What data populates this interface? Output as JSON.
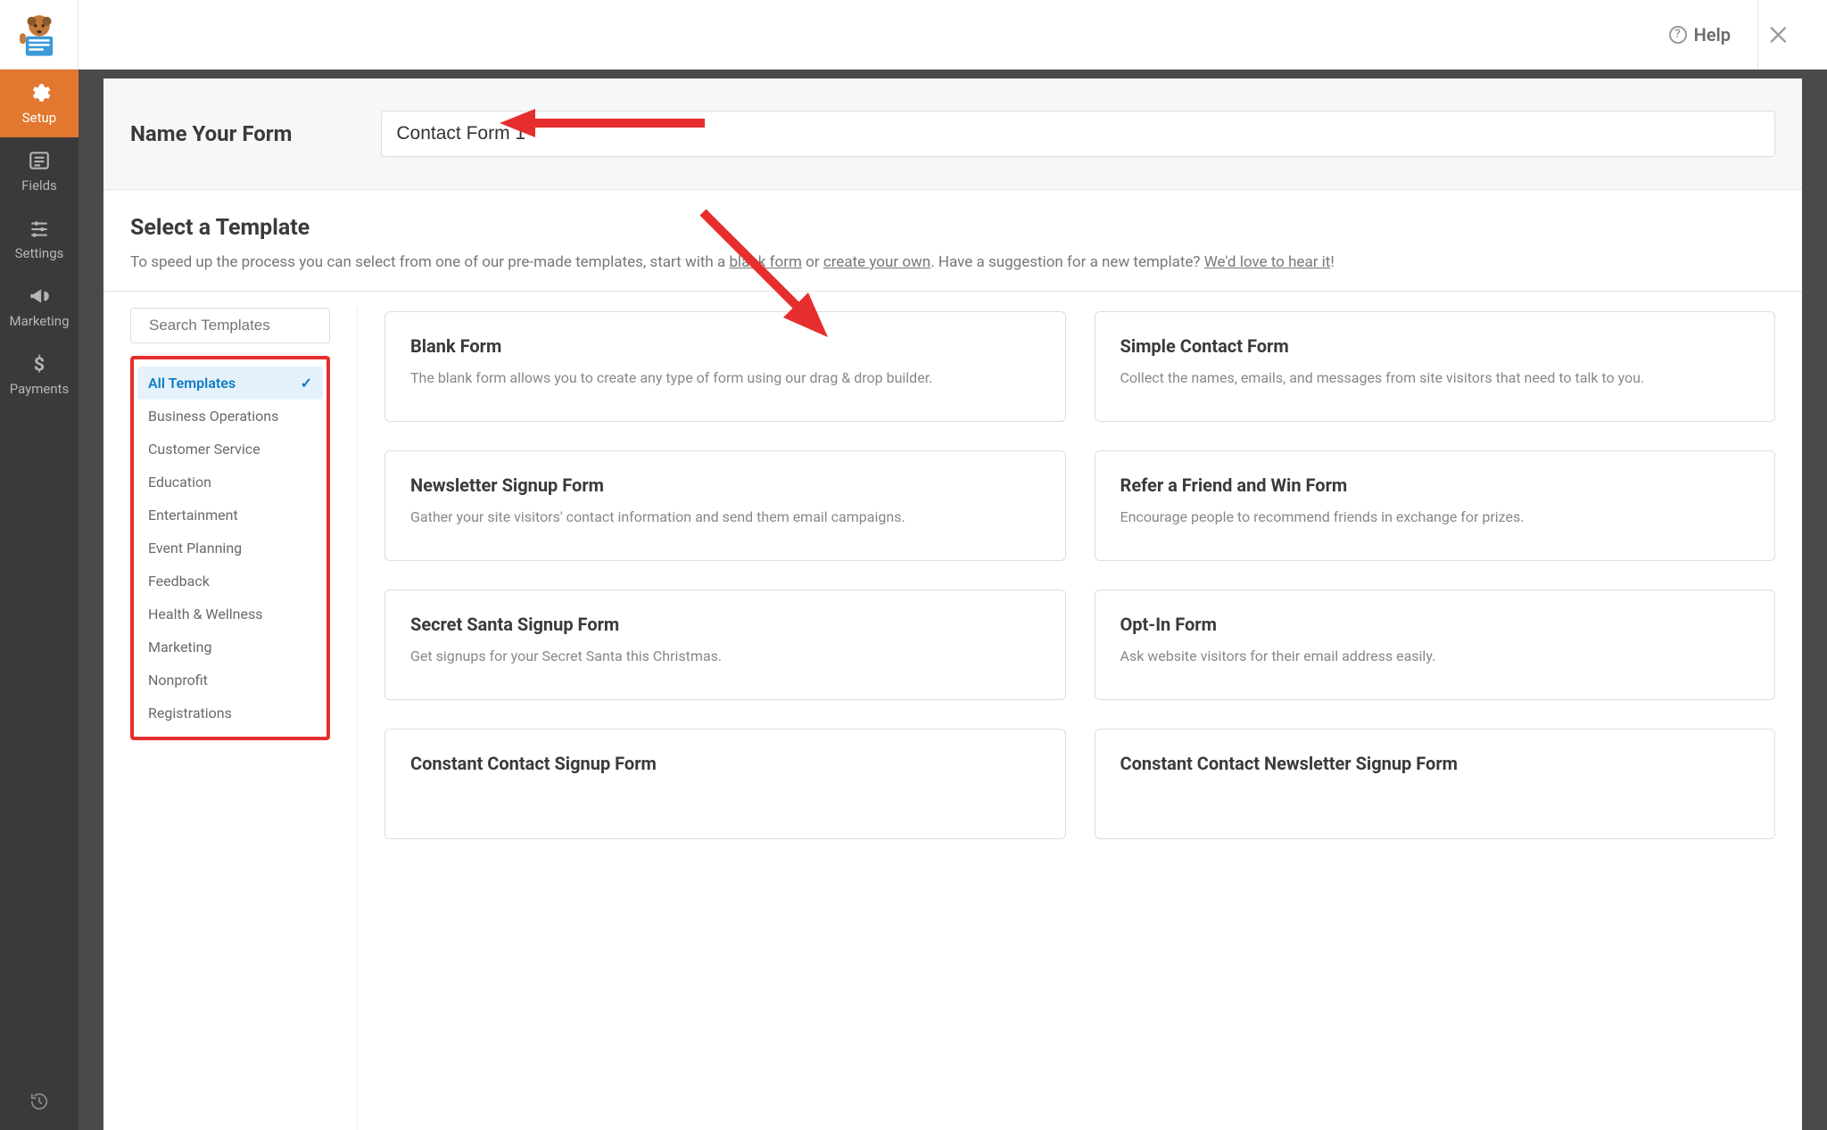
{
  "topbar": {
    "help_label": "Help"
  },
  "sidebar": {
    "items": [
      {
        "label": "Setup"
      },
      {
        "label": "Fields"
      },
      {
        "label": "Settings"
      },
      {
        "label": "Marketing"
      },
      {
        "label": "Payments"
      }
    ]
  },
  "name_section": {
    "label": "Name Your Form",
    "value": "Contact Form 1"
  },
  "template_header": {
    "title": "Select a Template",
    "desc_prefix": "To speed up the process you can select from one of our pre-made templates, start with a ",
    "link_blank": "blank form",
    "desc_or": " or ",
    "link_create": "create your own",
    "desc_suffix1": ". Have a suggestion for a new template? ",
    "link_suggest": "We'd love to hear it",
    "desc_suffix2": "!"
  },
  "search": {
    "placeholder": "Search Templates"
  },
  "categories": [
    "All Templates",
    "Business Operations",
    "Customer Service",
    "Education",
    "Entertainment",
    "Event Planning",
    "Feedback",
    "Health & Wellness",
    "Marketing",
    "Nonprofit",
    "Registrations"
  ],
  "templates": [
    {
      "title": "Blank Form",
      "desc": "The blank form allows you to create any type of form using our drag & drop builder."
    },
    {
      "title": "Simple Contact Form",
      "desc": "Collect the names, emails, and messages from site visitors that need to talk to you."
    },
    {
      "title": "Newsletter Signup Form",
      "desc": "Gather your site visitors' contact information and send them email campaigns."
    },
    {
      "title": "Refer a Friend and Win Form",
      "desc": "Encourage people to recommend friends in exchange for prizes."
    },
    {
      "title": "Secret Santa Signup Form",
      "desc": "Get signups for your Secret Santa this Christmas."
    },
    {
      "title": "Opt-In Form",
      "desc": "Ask website visitors for their email address easily."
    },
    {
      "title": "Constant Contact Signup Form",
      "desc": ""
    },
    {
      "title": "Constant Contact Newsletter Signup Form",
      "desc": ""
    }
  ]
}
